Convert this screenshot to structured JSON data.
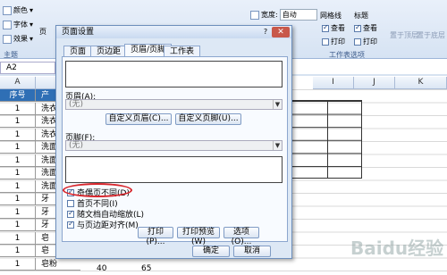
{
  "ribbon": {
    "left_items": [
      "颜色",
      "字体",
      "效果"
    ],
    "theme_group": "主题",
    "width_label": "宽度:",
    "width_value": "自动",
    "gridlines_title": "网格线",
    "headings_title": "标题",
    "view_label": "查看",
    "print_label": "打印",
    "sheet_options": "工作表选项",
    "page_label": "页",
    "bring_forward": "置于顶层",
    "send_backward": "置于底层"
  },
  "namebox": "A2",
  "columns": [
    "A",
    "I",
    "J",
    "K"
  ],
  "header_row": {
    "col_a": "序号",
    "col_b": "产"
  },
  "rows": [
    {
      "a": "1",
      "b": "洗衣"
    },
    {
      "a": "1",
      "b": "洗衣"
    },
    {
      "a": "1",
      "b": "洗衣"
    },
    {
      "a": "1",
      "b": "洗面"
    },
    {
      "a": "1",
      "b": "洗面"
    },
    {
      "a": "1",
      "b": "洗面"
    },
    {
      "a": "1",
      "b": "洗面"
    },
    {
      "a": "1",
      "b": "牙"
    },
    {
      "a": "1",
      "b": "牙"
    },
    {
      "a": "1",
      "b": "牙"
    },
    {
      "a": "1",
      "b": "皂"
    },
    {
      "a": "1",
      "b": "皂"
    },
    {
      "a": "1",
      "b": "皂粉"
    }
  ],
  "last_row_values": [
    "40",
    "65"
  ],
  "dialog": {
    "title": "页面设置",
    "help": "?",
    "close": "✕",
    "tabs": [
      "页面",
      "页边距",
      "页眉/页脚",
      "工作表"
    ],
    "header_label": "页眉(A):",
    "header_value": "(无)",
    "custom_header": "自定义页眉(C)...",
    "custom_footer": "自定义页脚(U)...",
    "footer_label": "页脚(F):",
    "footer_value": "(无)",
    "checkboxes": [
      {
        "label": "奇偶页不同(D)",
        "checked": true
      },
      {
        "label": "首页不同(I)",
        "checked": false
      },
      {
        "label": "随文档自动缩放(L)",
        "checked": true
      },
      {
        "label": "与页边距对齐(M)",
        "checked": true
      }
    ],
    "print_button": "打印(P)...",
    "preview_button": "打印预览(W)",
    "options_button": "选项(O)...",
    "ok_button": "确定",
    "cancel_button": "取消"
  },
  "watermark": "Baidu经验"
}
